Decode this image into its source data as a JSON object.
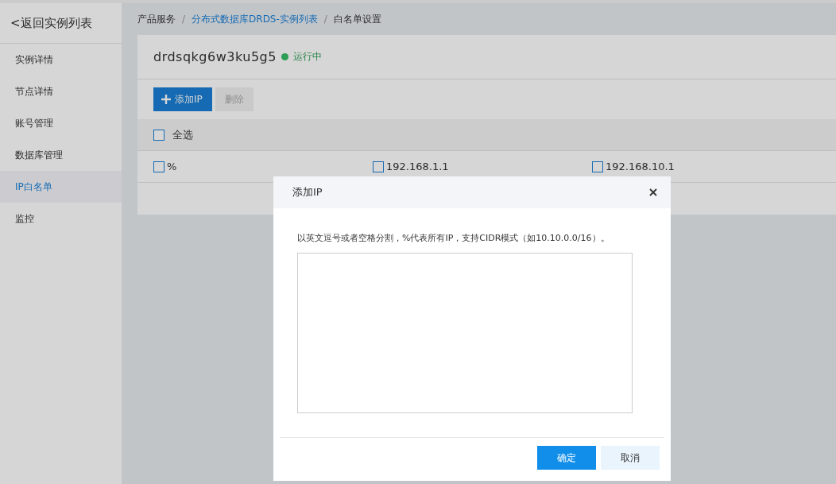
{
  "sidebar": {
    "back_link": "<返回实例列表",
    "items": [
      {
        "label": "实例详情",
        "selected": false
      },
      {
        "label": "节点详情",
        "selected": false
      },
      {
        "label": "账号管理",
        "selected": false
      },
      {
        "label": "数据库管理",
        "selected": false
      },
      {
        "label": "IP白名单",
        "selected": true
      },
      {
        "label": "监控",
        "selected": false
      }
    ]
  },
  "breadcrumb": [
    {
      "label": "产品服务",
      "link": false
    },
    {
      "separator": "/",
      "label": "分布式数据库DRDS-实例列表",
      "link": true
    },
    {
      "separator": "/",
      "label": "白名单设置",
      "link": false
    }
  ],
  "instance": {
    "name": "drdsqkg6w3ku5g5",
    "status": "运行中",
    "color": "#2e9e55"
  },
  "toolbar": {
    "add_button": {
      "label": "添加IP",
      "disabled": false
    },
    "delete_button": {
      "label": "删除",
      "disabled": true
    }
  },
  "select_all": {
    "label": "全选",
    "checked": false
  },
  "ips": [
    {
      "label": "%",
      "checked": false
    },
    {
      "label": "192.168.1.1",
      "checked": false
    },
    {
      "label": "192.168.10.1",
      "checked": false
    }
  ],
  "dialog": {
    "title": "添加IP",
    "hint": "以英文逗号或者空格分割，%代表所有IP，支持CIDR模式（如10.10.0.0/16）。",
    "buttons": [
      {
        "label": "确定",
        "kind": "primary"
      },
      {
        "label": "取消",
        "kind": "secondary"
      }
    ]
  }
}
